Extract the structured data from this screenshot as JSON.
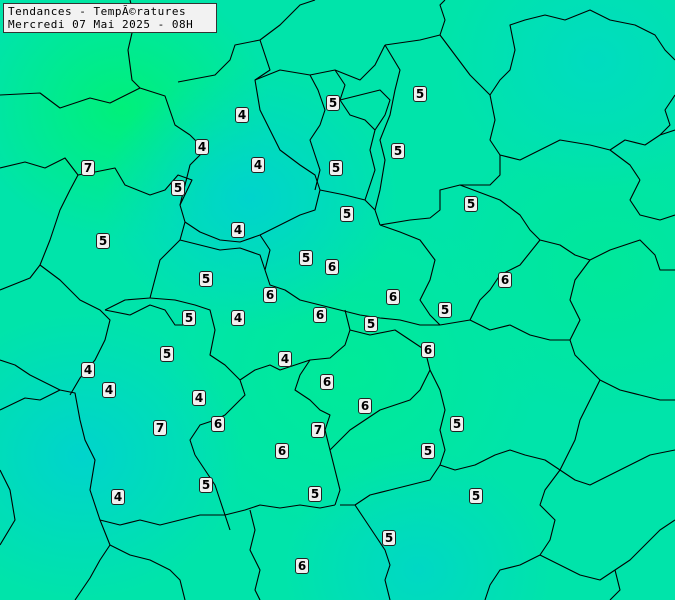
{
  "header": {
    "line1": "Tendances - TempÃ©ratures",
    "line2": "Mercredi 07 Mai 2025 - 08H"
  },
  "colors": {
    "cool": "#00d8c8",
    "mid": "#00e8a0",
    "warm": "#00f070",
    "border": "#000000",
    "badge_bg": "#f0f0f0"
  },
  "values": [
    {
      "id": "m1",
      "v": "4"
    },
    {
      "id": "m2",
      "v": "5"
    },
    {
      "id": "m3",
      "v": "5"
    },
    {
      "id": "m4",
      "v": "4"
    },
    {
      "id": "m5",
      "v": "7"
    },
    {
      "id": "m6",
      "v": "4"
    },
    {
      "id": "m7",
      "v": "5"
    },
    {
      "id": "m8",
      "v": "5"
    },
    {
      "id": "m9",
      "v": "5"
    },
    {
      "id": "m10",
      "v": "5"
    },
    {
      "id": "m11",
      "v": "4"
    },
    {
      "id": "m12",
      "v": "5"
    },
    {
      "id": "m13",
      "v": "5"
    },
    {
      "id": "m14",
      "v": "6"
    },
    {
      "id": "m15",
      "v": "6"
    },
    {
      "id": "m16",
      "v": "5"
    },
    {
      "id": "m17",
      "v": "6"
    },
    {
      "id": "m18",
      "v": "6"
    },
    {
      "id": "m19",
      "v": "6"
    },
    {
      "id": "m20",
      "v": "5"
    },
    {
      "id": "m21",
      "v": "4"
    },
    {
      "id": "m22",
      "v": "5"
    },
    {
      "id": "m23",
      "v": "6"
    },
    {
      "id": "m24",
      "v": "5"
    },
    {
      "id": "m25",
      "v": "4"
    },
    {
      "id": "m26",
      "v": "6"
    },
    {
      "id": "m27",
      "v": "4"
    },
    {
      "id": "m28",
      "v": "4"
    },
    {
      "id": "m29",
      "v": "6"
    },
    {
      "id": "m30",
      "v": "7"
    },
    {
      "id": "m31",
      "v": "6"
    },
    {
      "id": "m32",
      "v": "7"
    },
    {
      "id": "m33",
      "v": "5"
    },
    {
      "id": "m34",
      "v": "6"
    },
    {
      "id": "m35",
      "v": "5"
    },
    {
      "id": "m36",
      "v": "4"
    },
    {
      "id": "m37",
      "v": "5"
    },
    {
      "id": "m38",
      "v": "5"
    },
    {
      "id": "m39",
      "v": "5"
    },
    {
      "id": "m40",
      "v": "5"
    },
    {
      "id": "m41",
      "v": "6"
    }
  ]
}
